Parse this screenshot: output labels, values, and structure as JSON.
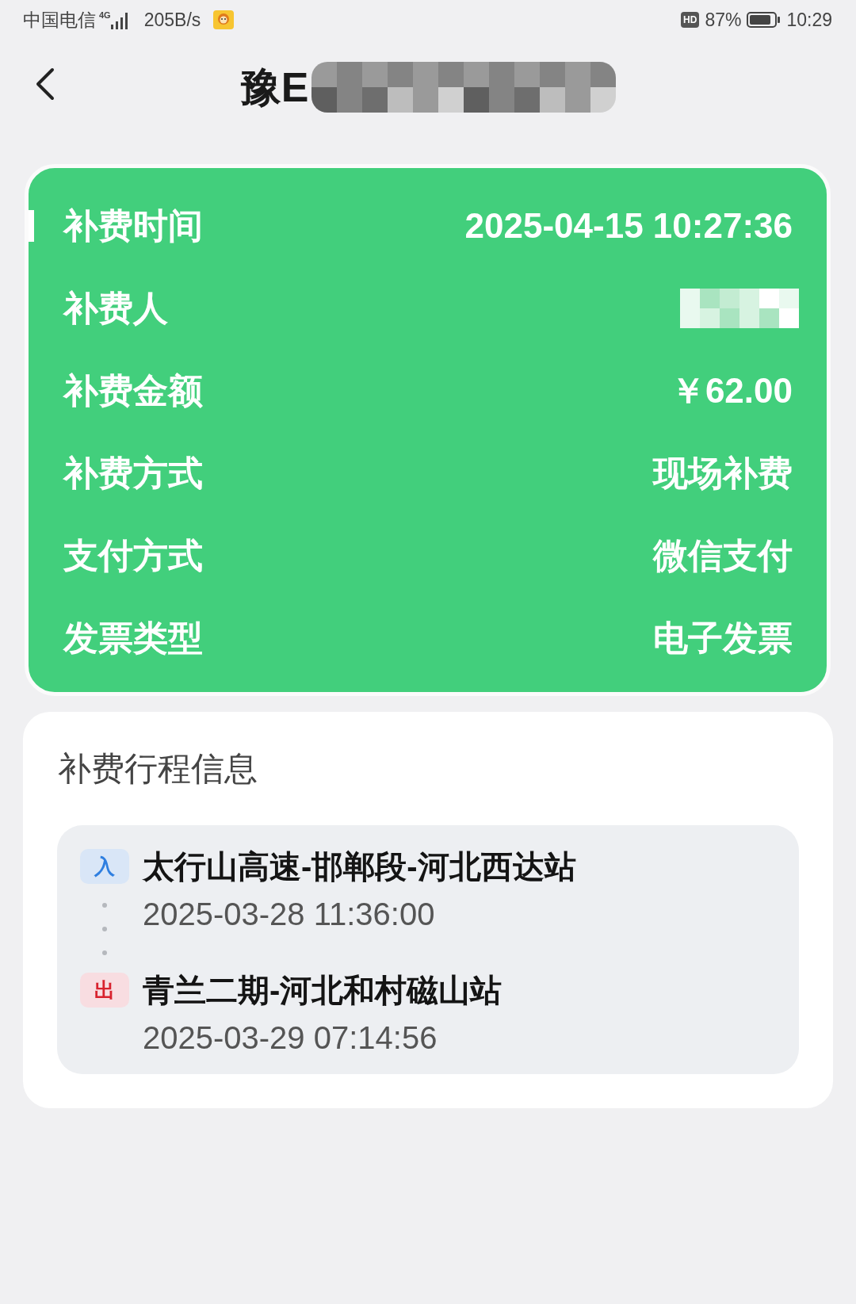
{
  "status_bar": {
    "carrier": "中国电信",
    "network": "4G",
    "speed": "205B/s",
    "hd": "HD",
    "battery": "87%",
    "time": "10:29"
  },
  "header": {
    "title": "豫E",
    "title_redacted": true
  },
  "payment_details": {
    "rows": [
      {
        "label": "补费时间",
        "kind": "text",
        "value": "2025-04-15 10:27:36",
        "highlighted": true
      },
      {
        "label": "补费人",
        "kind": "redacted",
        "highlighted": false
      },
      {
        "label": "补费金额",
        "kind": "text",
        "value": "￥62.00",
        "highlighted": false
      },
      {
        "label": "补费方式",
        "kind": "text",
        "value": "现场补费",
        "highlighted": false
      },
      {
        "label": "支付方式",
        "kind": "text",
        "value": "微信支付",
        "highlighted": false
      },
      {
        "label": "发票类型",
        "kind": "text",
        "value": "电子发票",
        "highlighted": false
      }
    ]
  },
  "trip": {
    "title": "补费行程信息",
    "stops": [
      {
        "kind": "entry",
        "badge": "入",
        "station": "太行山高速-邯郸段-河北西达站",
        "time": "2025-03-28 11:36:00"
      },
      {
        "kind": "exit",
        "badge": "出",
        "station": "青兰二期-河北和村磁山站",
        "time": "2025-03-29 07:14:56"
      }
    ]
  }
}
